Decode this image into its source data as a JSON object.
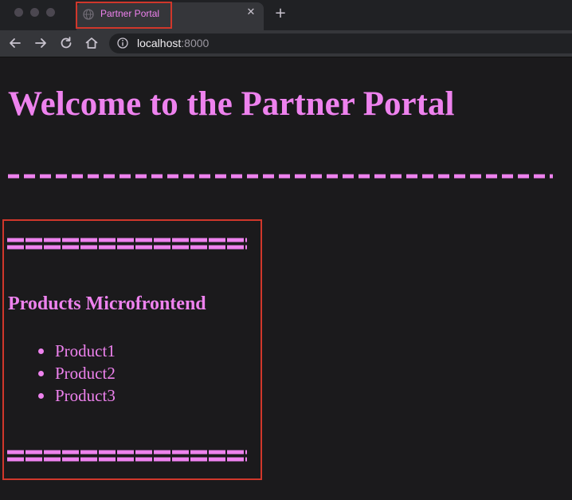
{
  "browser": {
    "tab_title": "Partner Portal",
    "tab_close_icon": "close-icon",
    "new_tab_icon": "plus-icon",
    "url_host": "localhost",
    "url_port": ":8000",
    "accent_color": "#ee82ee",
    "highlight_color": "#d0372b"
  },
  "page": {
    "title": "Welcome to the Partner Portal"
  },
  "products_mfe": {
    "title": "Products Microfrontend",
    "items": [
      "Product1",
      "Product2",
      "Product3"
    ]
  }
}
